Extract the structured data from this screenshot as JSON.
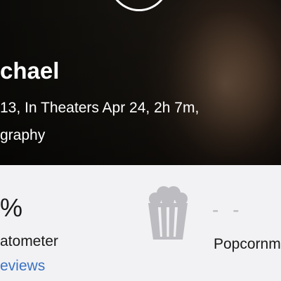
{
  "hero": {
    "title": "chael",
    "meta": "13, In Theaters Apr 24, 2h 7m,",
    "genre": "graphy",
    "play_icon": "play-circle-icon"
  },
  "scores": {
    "tomatometer": {
      "value": "%",
      "label": "atometer",
      "reviews_link": "eviews"
    },
    "popcornmeter": {
      "icon": "popcorn-bucket-icon",
      "value": "- -",
      "label": "Popcornm"
    }
  },
  "colors": {
    "link": "#3a72c4",
    "placeholder_score": "#b9b9bd",
    "background": "#f2f2f4"
  }
}
